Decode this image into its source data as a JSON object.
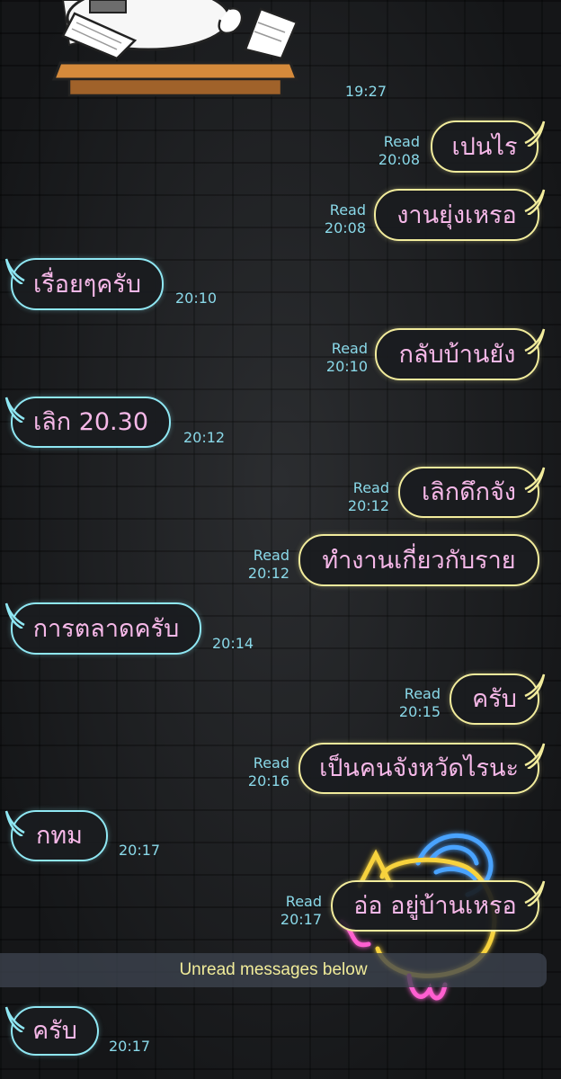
{
  "colors": {
    "sent_border": "#f2ec9c",
    "received_border": "#8fe7f3",
    "message_text": "#f6b8e8",
    "meta_text": "#8ad9e9",
    "unread_text": "#f1ec9a"
  },
  "top_sticker": {
    "time": "19:27"
  },
  "messages": [
    {
      "text": "เปนไร",
      "read": "Read",
      "time": "20:08"
    },
    {
      "text": "งานยุ่งเหรอ",
      "read": "Read",
      "time": "20:08"
    },
    {
      "text": "เรื่อยๆครับ",
      "time": "20:10"
    },
    {
      "text": "กลับบ้านยัง",
      "read": "Read",
      "time": "20:10"
    },
    {
      "text": "เลิก 20.30",
      "time": "20:12"
    },
    {
      "text": "เลิกดึกจัง",
      "read": "Read",
      "time": "20:12"
    },
    {
      "text": "ทำงานเกี่ยวกับราย",
      "read": "Read",
      "time": "20:12"
    },
    {
      "text": "การตลาดครับ",
      "time": "20:14"
    },
    {
      "text": "ครับ",
      "read": "Read",
      "time": "20:15"
    },
    {
      "text": "เป็นคนจังหวัดไรนะ",
      "read": "Read",
      "time": "20:16"
    },
    {
      "text": "กทม",
      "time": "20:17"
    },
    {
      "text": "อ่อ อยู่บ้านเหรอ",
      "read": "Read",
      "time": "20:17"
    },
    {
      "text": "ครับ",
      "time": "20:17"
    }
  ],
  "unread_divider": "Unread messages below"
}
